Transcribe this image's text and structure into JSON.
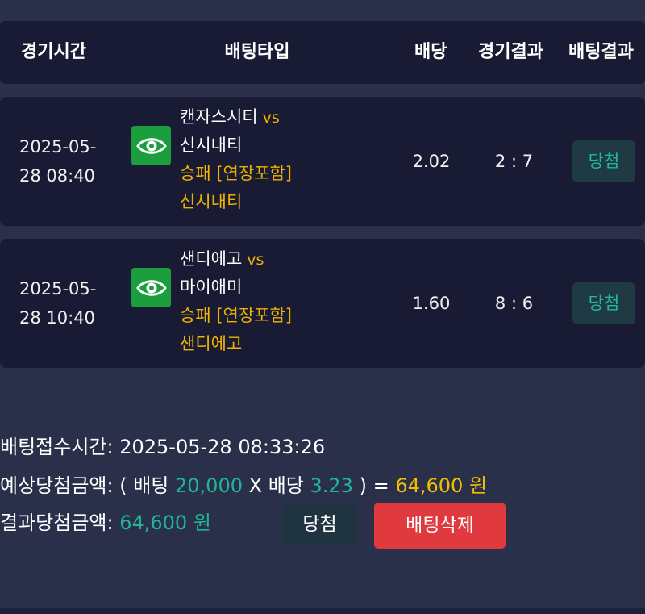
{
  "header": {
    "time": "경기시간",
    "bet_type": "배팅타입",
    "odds": "배당",
    "game_result": "경기결과",
    "bet_result": "배팅결과"
  },
  "bets": [
    {
      "date": "2025-05-",
      "time": "28 08:40",
      "home": "캔자스시티",
      "vs": "vs",
      "away": "신시내티",
      "market": "승패 [연장포함]",
      "pick": "신시내티",
      "odds": "2.02",
      "score": "2 : 7",
      "result": "당첨",
      "icon": "eye-icon"
    },
    {
      "date": "2025-05-",
      "time": "28 10:40",
      "home": "샌디에고",
      "vs": "vs",
      "away": "마이애미",
      "market": "승패 [연장포함]",
      "pick": "샌디에고",
      "odds": "1.60",
      "score": "8 : 6",
      "result": "당첨",
      "icon": "eye-icon"
    }
  ],
  "summary": {
    "received_label": "배팅접수시간:",
    "received_value": "2025-05-28 08:33:26",
    "expected_label": "예상당첨금액:",
    "expected_open": "( 배팅",
    "bet_amount": "20,000",
    "times": "X 배당",
    "total_odds": "3.23",
    "close_eq": ") =",
    "expected_amount": "64,600 원",
    "actual_label": "결과당첨금액:",
    "actual_amount": "64,600 원"
  },
  "buttons": {
    "win": "당첨",
    "delete": "배팅삭제"
  },
  "colors": {
    "background": "#2a2f4a",
    "row": "#181b33",
    "gold": "#f0b400",
    "teal": "#1fb596",
    "eye_button": "#1a9e3e",
    "delete": "#e03a3e"
  }
}
